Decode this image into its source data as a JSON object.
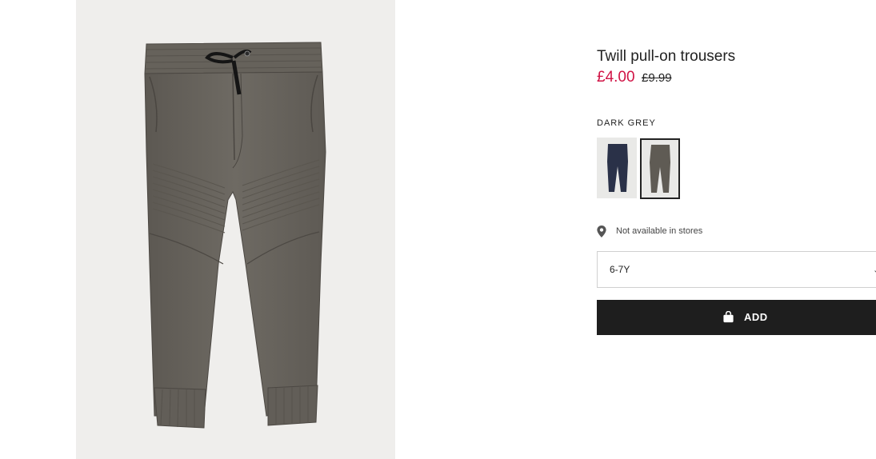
{
  "product": {
    "title": "Twill pull-on trousers",
    "price_sale": "£4.00",
    "price_original": "£9.99",
    "image_icon": "trousers-photo"
  },
  "colors": {
    "selected_label": "DARK GREY",
    "swatches": [
      {
        "name": "navy-trousers-swatch",
        "fill": "#2a3148"
      },
      {
        "name": "dark-grey-trousers-swatch",
        "fill": "#5f5b54",
        "selected": true
      }
    ]
  },
  "availability": {
    "icon": "map-pin-icon",
    "text": "Not available in stores"
  },
  "size": {
    "selected": "6-7Y",
    "icon": "chevron-down-icon"
  },
  "cart": {
    "add_label": "ADD",
    "icon": "shopping-bag-icon"
  },
  "theme": {
    "sale_color": "#d01345",
    "button_bg": "#1e1e1e",
    "trousers_color": "#6a655e"
  }
}
